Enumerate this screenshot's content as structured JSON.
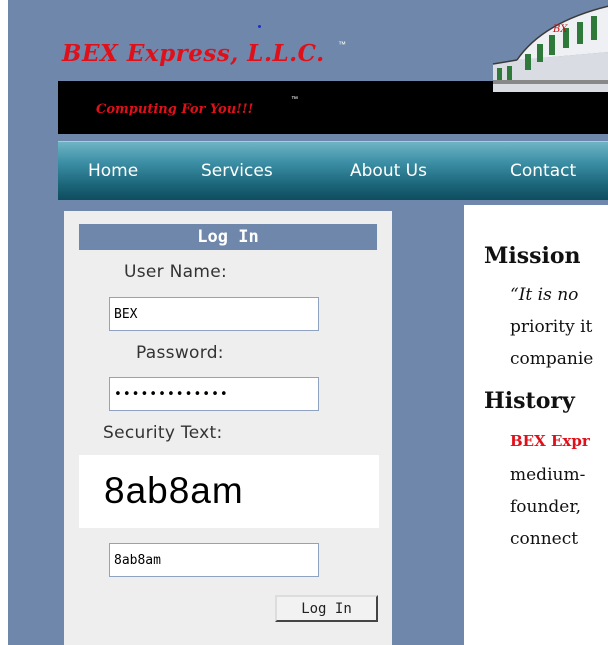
{
  "header": {
    "company_name": "BEX Express, L.L.C.",
    "company_tm": "™",
    "tagline": "Computing For You!!!",
    "tagline_tm": "™"
  },
  "nav": {
    "items": [
      {
        "label": "Home"
      },
      {
        "label": "Services"
      },
      {
        "label": "About Us"
      },
      {
        "label": "Contact"
      }
    ]
  },
  "login": {
    "title": "Log In",
    "username_label": "User Name:",
    "username_value": "BEX",
    "password_label": "Password:",
    "password_value": "•••••••••••••",
    "security_label": "Security Text:",
    "captcha_text": "8ab8am",
    "security_value": "8ab8am",
    "button_label": "Log In"
  },
  "content": {
    "mission_heading": "Mission",
    "mission_lines": [
      "“It is no",
      "priority it",
      "companie"
    ],
    "history_heading": "History",
    "history_red": "BEX Expr",
    "history_lines": [
      "medium-",
      "founder,",
      "connect"
    ]
  },
  "colors": {
    "page_bg": "#6f87aa",
    "accent_red": "#e0101a",
    "nav_top": "#6fb4c5",
    "nav_bottom": "#0f4c5f"
  }
}
